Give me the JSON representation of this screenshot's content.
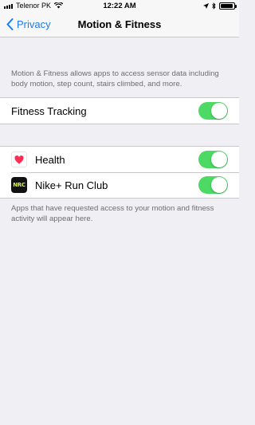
{
  "status_bar": {
    "carrier": "Telenor PK",
    "time": "12:22 AM",
    "icons": [
      "signal-bars-icon",
      "wifi-icon",
      "location-arrow-icon",
      "bluetooth-icon",
      "battery-icon"
    ]
  },
  "nav": {
    "back_label": "Privacy",
    "title": "Motion & Fitness"
  },
  "description": "Motion & Fitness allows apps to access sensor data including body motion, step count, stairs climbed, and more.",
  "fitness_tracking": {
    "label": "Fitness Tracking",
    "enabled": true
  },
  "apps": [
    {
      "name": "Health",
      "icon": "heart-icon",
      "enabled": true
    },
    {
      "name": "Nike+ Run Club",
      "icon": "nrc-icon",
      "icon_text": "NRC",
      "enabled": true
    }
  ],
  "footer": "Apps that have requested access to your motion and fitness activity will appear here.",
  "colors": {
    "accent": "#1a7cf6",
    "toggle_on": "#4cd964",
    "background": "#efeff4",
    "heart": "#ff2d55",
    "nrc_text": "#d5f83a"
  }
}
